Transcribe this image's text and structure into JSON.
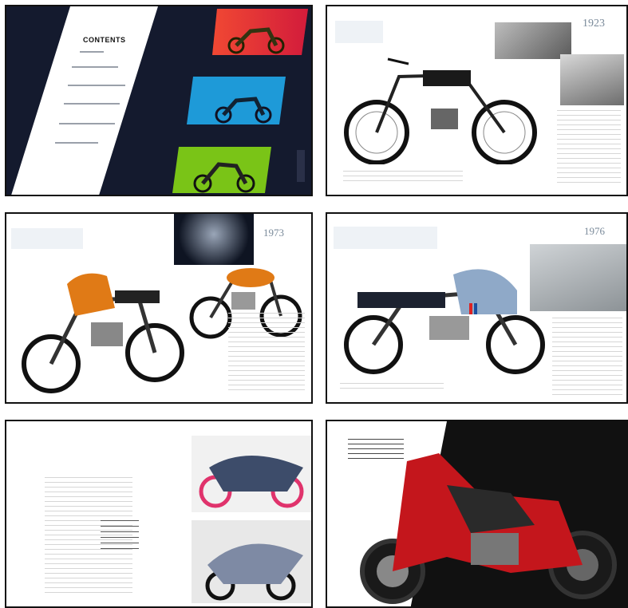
{
  "contents_spread": {
    "heading": "CONTENTS",
    "entries": [
      "",
      "",
      "",
      "",
      "",
      ""
    ]
  },
  "spread_1923": {
    "year": "1923"
  },
  "spread_1973": {
    "year": "1973"
  },
  "spread_1976": {
    "year": "1976"
  },
  "colors": {
    "contents_bg": "#141a2e",
    "red_swatch": "#e2272c",
    "blue_swatch": "#1e9ad8",
    "green_swatch": "#7ac417",
    "orange_bike": "#e07a16",
    "racing_red": "#c4161c"
  }
}
